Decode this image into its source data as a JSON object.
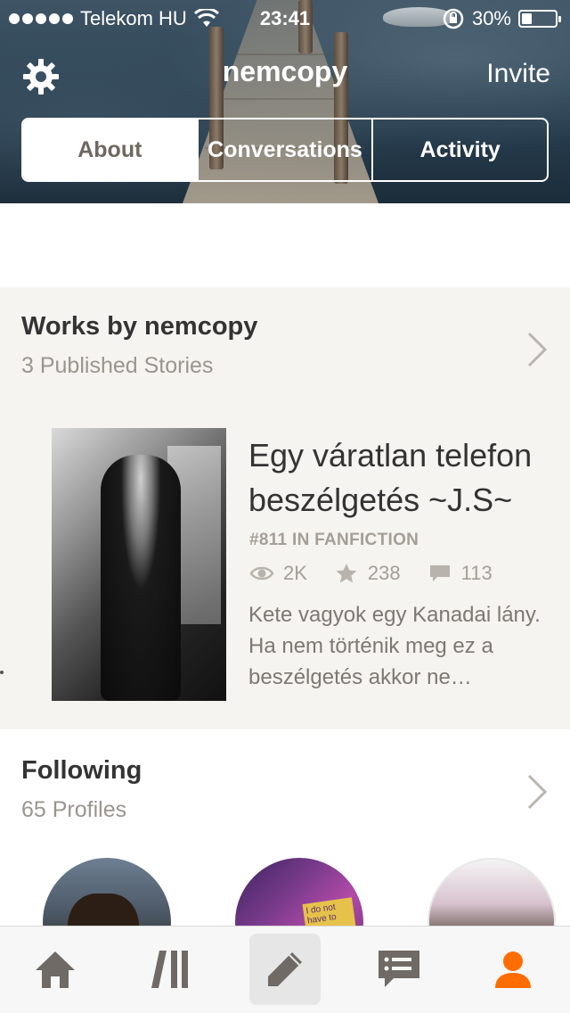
{
  "status_bar": {
    "carrier": "Telekom HU",
    "time": "23:41",
    "battery": "30%",
    "battery_level": 0.3
  },
  "header": {
    "title": "nemcopy",
    "invite_label": "Invite",
    "tabs": [
      {
        "label": "About",
        "selected": true
      },
      {
        "label": "Conversations",
        "selected": false
      },
      {
        "label": "Activity",
        "selected": false
      }
    ]
  },
  "works": {
    "title": "Works by nemcopy",
    "subtitle": "3 Published Stories",
    "story": {
      "title": "Egy váratlan telefon beszélgetés ~J.S~",
      "rank": "#811 IN FANFICTION",
      "reads": "2K",
      "votes": "238",
      "comments": "113",
      "description": "Kete vagyok egy Kanadai lány. Ha nem történik meg ez a beszélgetés akkor ne…"
    }
  },
  "following": {
    "title": "Following",
    "subtitle": "65 Profiles",
    "avatar_text": "I do not have to"
  },
  "tab_bar": {
    "items": [
      "home-icon",
      "library-icon",
      "write-icon",
      "messages-icon",
      "profile-icon"
    ],
    "active": "profile-icon",
    "accent_color": "#ff6d00"
  }
}
